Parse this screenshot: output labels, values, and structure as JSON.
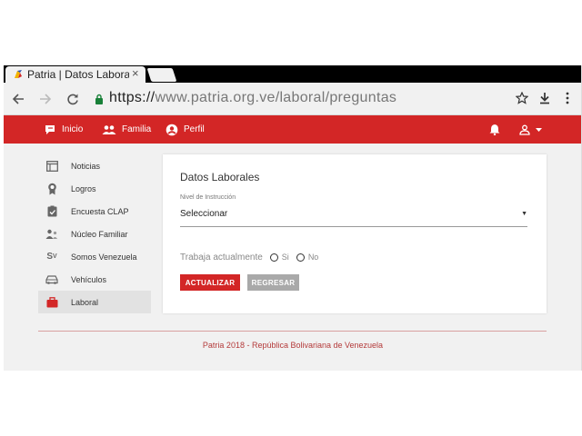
{
  "browser": {
    "tab": {
      "title": "Patria | Datos Laborale",
      "close": "×"
    },
    "url": {
      "scheme": "https://",
      "rest": "www.patria.org.ve/laboral/preguntas"
    },
    "buttons": [
      "back-icon",
      "forward-icon",
      "reload-icon",
      "star-icon",
      "download-icon",
      "menu-icon"
    ]
  },
  "appbar": {
    "items": [
      {
        "label": "Inicio",
        "icon": "chat-icon"
      },
      {
        "label": "Familia",
        "icon": "people-icon"
      },
      {
        "label": "Perfil",
        "icon": "account-circle-icon"
      }
    ],
    "right_icons": [
      "bell-icon",
      "user-icon",
      "caret-down-icon"
    ],
    "color": "#d32626"
  },
  "sidebar": {
    "items": [
      {
        "label": "Noticias",
        "icon": "news-icon"
      },
      {
        "label": "Logros",
        "icon": "medal-icon"
      },
      {
        "label": "Encuesta CLAP",
        "icon": "clipboard-icon"
      },
      {
        "label": "Núcleo Familiar",
        "icon": "family-icon"
      },
      {
        "label": "Somos Venezuela",
        "icon": "sv-icon"
      },
      {
        "label": "Vehículos",
        "icon": "car-icon"
      },
      {
        "label": "Laboral",
        "icon": "briefcase-icon",
        "active": true
      }
    ]
  },
  "form": {
    "title": "Datos Laborales",
    "education_label": "Nivel de Instrucción",
    "education_value": "Seleccionar",
    "working_label": "Trabaja actualmente",
    "options": [
      "Si",
      "No"
    ],
    "submit_label": "ACTUALIZAR",
    "back_label": "REGRESAR"
  },
  "footer": {
    "text": "Patria 2018 - República Bolivariana de Venezuela"
  }
}
